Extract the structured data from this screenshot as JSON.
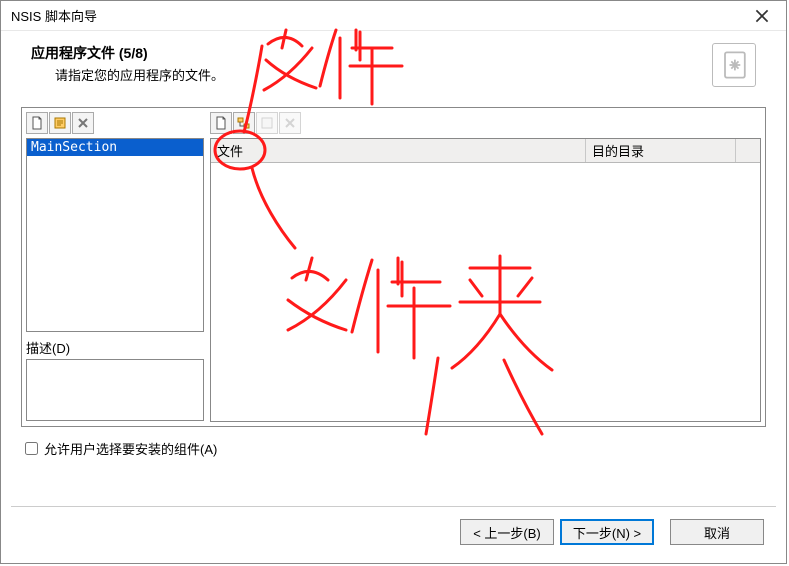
{
  "window": {
    "title": "NSIS 脚本向导"
  },
  "header": {
    "title": "应用程序文件  (5/8)",
    "subtitle": "请指定您的应用程序的文件。"
  },
  "sections": {
    "items": [
      {
        "name": "MainSection"
      }
    ],
    "description_label": "描述(D)"
  },
  "fileList": {
    "col_file": "文件",
    "col_dest": "目的目录"
  },
  "checkbox": {
    "label": "允许用户选择要安装的组件(A)"
  },
  "buttons": {
    "prev": "< 上一步(B)",
    "next": "下一步(N) >",
    "cancel": "取消"
  },
  "annotations": {
    "top": "文件",
    "middle": "文件夹"
  }
}
